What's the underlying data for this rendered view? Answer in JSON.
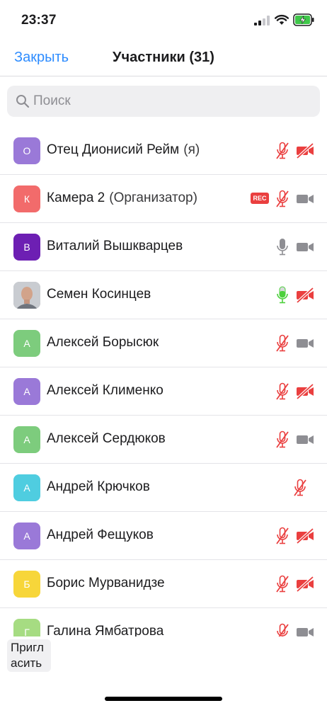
{
  "status_bar": {
    "time": "23:37",
    "icons": [
      "signal-icon",
      "wifi-icon",
      "battery-charging-icon"
    ],
    "battery_color": "#3fc74a"
  },
  "header": {
    "close_label": "Закрыть",
    "title": "Участники (31)"
  },
  "search": {
    "placeholder": "Поиск",
    "value": ""
  },
  "participants": [
    {
      "initial": "О",
      "avatar_color": "#9a79d8",
      "name": "Отец Дионисий Рейм",
      "suffix": "(я)",
      "rec": false,
      "mic": "muted",
      "video": "off"
    },
    {
      "initial": "К",
      "avatar_color": "#f26b6b",
      "name": "Камера 2",
      "suffix": "(Организатор)",
      "rec": true,
      "mic": "muted",
      "video": "on"
    },
    {
      "initial": "В",
      "avatar_color": "#6d1fb3",
      "name": "Виталий Вышкварцев",
      "suffix": "",
      "rec": false,
      "mic": "on",
      "video": "on"
    },
    {
      "initial": "",
      "avatar_color": "photo",
      "name": "Семен Косинцев",
      "suffix": "",
      "rec": false,
      "mic": "speaking",
      "video": "off"
    },
    {
      "initial": "А",
      "avatar_color": "#7dcc7d",
      "name": "Алексей Борысюк",
      "suffix": "",
      "rec": false,
      "mic": "muted",
      "video": "on"
    },
    {
      "initial": "А",
      "avatar_color": "#9a79d8",
      "name": "Алексей Клименко",
      "suffix": "",
      "rec": false,
      "mic": "muted",
      "video": "off"
    },
    {
      "initial": "А",
      "avatar_color": "#7dcc7d",
      "name": "Алексей Сердюков",
      "suffix": "",
      "rec": false,
      "mic": "muted",
      "video": "on"
    },
    {
      "initial": "А",
      "avatar_color": "#4fcde0",
      "name": "Андрей Крючков",
      "suffix": "",
      "rec": false,
      "mic": "muted",
      "video": "none"
    },
    {
      "initial": "А",
      "avatar_color": "#9a79d8",
      "name": "Андрей Фещуков",
      "suffix": "",
      "rec": false,
      "mic": "muted",
      "video": "off"
    },
    {
      "initial": "Б",
      "avatar_color": "#f7d63a",
      "name": "Борис Мурванидзе",
      "suffix": "",
      "rec": false,
      "mic": "muted",
      "video": "off"
    },
    {
      "initial": "Г",
      "avatar_color": "#a6dc82",
      "name": "Галина Ямбатрова",
      "suffix": "",
      "rec": false,
      "mic": "muted",
      "video": "on"
    }
  ],
  "rec_label": "REC",
  "footer": {
    "invite_label": "Пригл асить"
  },
  "colors": {
    "accent": "#2d8cff",
    "muted_red": "#ea3f3f",
    "icon_gray": "#8e8e93",
    "speaking_green": "#4cd03c"
  }
}
